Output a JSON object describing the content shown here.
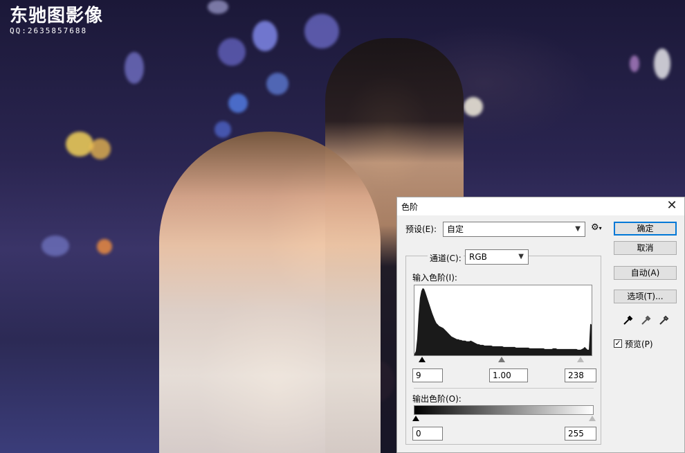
{
  "watermark": {
    "title": "东驰图影像",
    "contact": "QQ:2635857688"
  },
  "dialog": {
    "title": "色阶",
    "close_symbol": "✕",
    "preset": {
      "label": "预设(E):",
      "value": "自定"
    },
    "channel": {
      "label": "通道(C):",
      "value": "RGB"
    },
    "input_levels": {
      "label": "输入色阶(I):",
      "black": "9",
      "gamma": "1.00",
      "white": "238"
    },
    "output_levels": {
      "label": "输出色阶(O):",
      "black": "0",
      "white": "255"
    },
    "buttons": {
      "ok": "确定",
      "cancel": "取消",
      "auto": "自动(A)",
      "options": "选项(T)..."
    },
    "preview": {
      "label": "预览(P)",
      "checked": true
    },
    "histogram": [
      2,
      6,
      24,
      58,
      82,
      92,
      96,
      95,
      90,
      84,
      78,
      72,
      66,
      60,
      55,
      50,
      46,
      44,
      42,
      41,
      40,
      39,
      37,
      35,
      33,
      31,
      29,
      27,
      26,
      25,
      24,
      23,
      23,
      22,
      22,
      21,
      21,
      21,
      20,
      20,
      20,
      21,
      20,
      19,
      18,
      17,
      16,
      16,
      15,
      15,
      15,
      14,
      14,
      14,
      14,
      14,
      14,
      13,
      13,
      13,
      13,
      13,
      13,
      13,
      13,
      12,
      12,
      12,
      12,
      12,
      12,
      12,
      12,
      12,
      11,
      11,
      11,
      11,
      11,
      11,
      11,
      11,
      11,
      11,
      10,
      10,
      10,
      10,
      10,
      10,
      10,
      10,
      10,
      10,
      10,
      9,
      9,
      9,
      9,
      9,
      9,
      10,
      10,
      10,
      9,
      9,
      9,
      9,
      9,
      9,
      9,
      9,
      9,
      9,
      9,
      9,
      9,
      9,
      9,
      8,
      8,
      8,
      9,
      10,
      12,
      10,
      8,
      8,
      45,
      44
    ],
    "colors": {
      "accent": "#0078d7",
      "histogram_fill": "#1a1a1a"
    }
  }
}
